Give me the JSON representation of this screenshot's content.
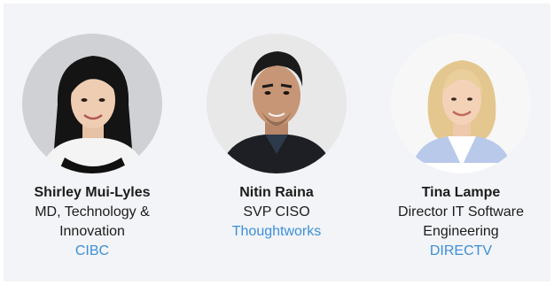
{
  "speakers": [
    {
      "name": "Shirley Mui-Lyles",
      "title": "MD, Technology & Innovation",
      "company": "CIBC",
      "avatar_icon": "person-photo-icon"
    },
    {
      "name": "Nitin Raina",
      "title": "SVP CISO",
      "company": "Thoughtworks",
      "avatar_icon": "person-photo-icon"
    },
    {
      "name": "Tina Lampe",
      "title": "Director IT Software Engineering",
      "company": "DIRECTV",
      "avatar_icon": "person-photo-icon"
    }
  ],
  "colors": {
    "panel_bg": "#f3f4f7",
    "company_link": "#3b8fd9",
    "text": "#1c1c1c"
  }
}
